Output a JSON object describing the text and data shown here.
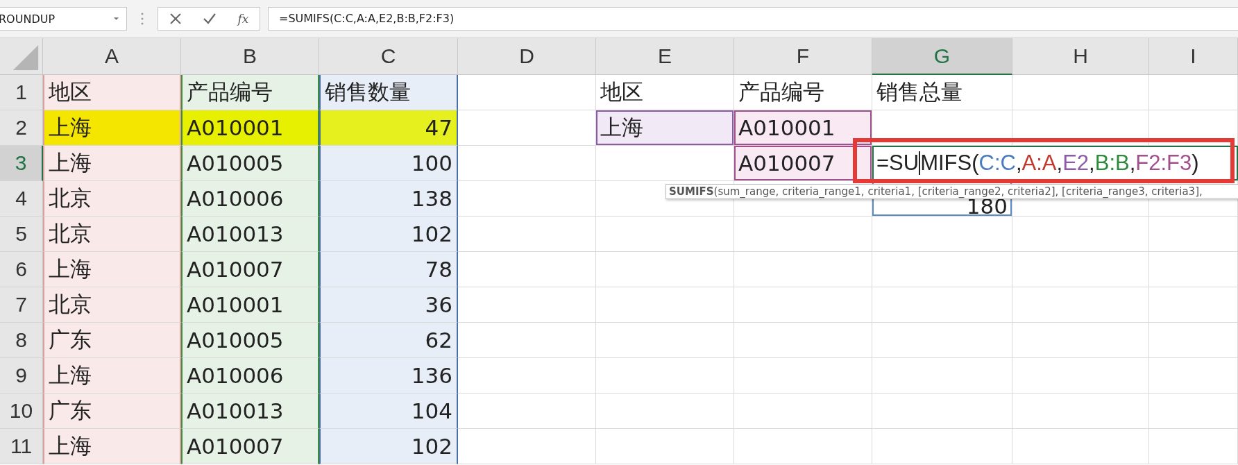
{
  "formula_bar": {
    "name_box": "ROUNDUP",
    "function_label": "fx",
    "formula": "=SUMIFS(C:C,A:A,E2,B:B,F2:F3)"
  },
  "columns": [
    {
      "label": "A",
      "selected": false,
      "border": {
        "color": "#d9a0a0"
      }
    },
    {
      "label": "B",
      "selected": false,
      "border": {
        "color": "#3c8c3c"
      }
    },
    {
      "label": "C",
      "selected": false,
      "border": {
        "color": "#4a6fa5"
      }
    },
    {
      "label": "D",
      "selected": false
    },
    {
      "label": "E",
      "selected": false
    },
    {
      "label": "F",
      "selected": false
    },
    {
      "label": "G",
      "selected": true
    },
    {
      "label": "H",
      "selected": false
    },
    {
      "label": "I",
      "selected": false
    }
  ],
  "rows": [
    {
      "label": "1",
      "selected": false,
      "cells": [
        {
          "text": "地区",
          "kind": "text",
          "color": "#f9e9e9"
        },
        {
          "text": "产品编号",
          "kind": "text",
          "color": "#e6f2e6"
        },
        {
          "text": "销售数量",
          "kind": "text",
          "color": "#e8eef8"
        },
        {},
        {
          "text": "地区",
          "kind": "text"
        },
        {
          "text": "产品编号",
          "kind": "text"
        },
        {
          "text": "销售总量",
          "kind": "text"
        },
        {},
        {}
      ]
    },
    {
      "label": "2",
      "selected": false,
      "cells": [
        {
          "text": "上海",
          "kind": "text",
          "color": "#f5e600"
        },
        {
          "text": "A010001",
          "kind": "text",
          "color": "#e6f000"
        },
        {
          "text": "47",
          "kind": "number",
          "color": "#e6f01e"
        },
        {},
        {
          "text": "上海",
          "kind": "text",
          "color": "#f1e9f5",
          "border": {
            "color": "#8e5aa8"
          }
        },
        {
          "text": "A010001",
          "kind": "text",
          "color": "#f9e9f3",
          "border": {
            "color": "#a0508c"
          }
        },
        {},
        {},
        {}
      ]
    },
    {
      "label": "3",
      "selected": true,
      "cells": [
        {
          "text": "上海",
          "kind": "text",
          "color": "#f9e9e9"
        },
        {
          "text": "A010005",
          "kind": "text",
          "color": "#e6f2e6"
        },
        {
          "text": "100",
          "kind": "number",
          "color": "#e8eef8"
        },
        {},
        {},
        {
          "text": "A010007",
          "kind": "text",
          "color": "#f9e9f3",
          "border": {
            "color": "#a0508c"
          }
        },
        {
          "editing": true,
          "segments": [
            {
              "text": "=SU",
              "color": "#222222",
              "cursor": true
            },
            {
              "text": "MIFS(",
              "color": "#222222"
            },
            {
              "text": "C:C",
              "color": "#4a7cc0"
            },
            {
              "text": ",",
              "color": "#222222"
            },
            {
              "text": "A:A",
              "color": "#c0392b"
            },
            {
              "text": ",",
              "color": "#222222"
            },
            {
              "text": "E2",
              "color": "#8e5aa8"
            },
            {
              "text": ",",
              "color": "#222222"
            },
            {
              "text": "B:B",
              "color": "#2e8b3a"
            },
            {
              "text": ",",
              "color": "#222222"
            },
            {
              "text": "F2:F3",
              "color": "#a0508c"
            },
            {
              "text": ")",
              "color": "#222222"
            }
          ]
        },
        {},
        {}
      ]
    },
    {
      "label": "4",
      "selected": false,
      "cells": [
        {
          "text": "北京",
          "kind": "text",
          "color": "#f9e9e9"
        },
        {
          "text": "A010006",
          "kind": "text",
          "color": "#e6f2e6"
        },
        {
          "text": "138",
          "kind": "number",
          "color": "#e8eef8"
        },
        {},
        {},
        {},
        {
          "text": "180",
          "kind": "number",
          "border": {
            "color": "#5b8bc9"
          }
        },
        {},
        {}
      ]
    },
    {
      "label": "5",
      "selected": false,
      "cells": [
        {
          "text": "北京",
          "kind": "text",
          "color": "#f9e9e9"
        },
        {
          "text": "A010013",
          "kind": "text",
          "color": "#e6f2e6"
        },
        {
          "text": "102",
          "kind": "number",
          "color": "#e8eef8"
        },
        {},
        {},
        {},
        {},
        {},
        {}
      ]
    },
    {
      "label": "6",
      "selected": false,
      "cells": [
        {
          "text": "上海",
          "kind": "text",
          "color": "#f9e9e9"
        },
        {
          "text": "A010007",
          "kind": "text",
          "color": "#e6f2e6"
        },
        {
          "text": "78",
          "kind": "number",
          "color": "#e8eef8"
        },
        {},
        {},
        {},
        {},
        {},
        {}
      ]
    },
    {
      "label": "7",
      "selected": false,
      "cells": [
        {
          "text": "北京",
          "kind": "text",
          "color": "#f9e9e9"
        },
        {
          "text": "A010001",
          "kind": "text",
          "color": "#e6f2e6"
        },
        {
          "text": "36",
          "kind": "number",
          "color": "#e8eef8"
        },
        {},
        {},
        {},
        {},
        {},
        {}
      ]
    },
    {
      "label": "8",
      "selected": false,
      "cells": [
        {
          "text": "广东",
          "kind": "text",
          "color": "#f9e9e9"
        },
        {
          "text": "A010005",
          "kind": "text",
          "color": "#e6f2e6"
        },
        {
          "text": "62",
          "kind": "number",
          "color": "#e8eef8"
        },
        {},
        {},
        {},
        {},
        {},
        {}
      ]
    },
    {
      "label": "9",
      "selected": false,
      "cells": [
        {
          "text": "上海",
          "kind": "text",
          "color": "#f9e9e9"
        },
        {
          "text": "A010006",
          "kind": "text",
          "color": "#e6f2e6"
        },
        {
          "text": "136",
          "kind": "number",
          "color": "#e8eef8"
        },
        {},
        {},
        {},
        {},
        {},
        {}
      ]
    },
    {
      "label": "10",
      "selected": false,
      "cells": [
        {
          "text": "广东",
          "kind": "text",
          "color": "#f9e9e9"
        },
        {
          "text": "A010013",
          "kind": "text",
          "color": "#e6f2e6"
        },
        {
          "text": "104",
          "kind": "number",
          "color": "#e8eef8"
        },
        {},
        {},
        {},
        {},
        {},
        {}
      ]
    },
    {
      "label": "11",
      "selected": false,
      "cells": [
        {
          "text": "上海",
          "kind": "text",
          "color": "#f9e9e9"
        },
        {
          "text": "A010007",
          "kind": "text",
          "color": "#e6f2e6"
        },
        {
          "text": "102",
          "kind": "number",
          "color": "#e8eef8"
        },
        {},
        {},
        {},
        {},
        {},
        {}
      ]
    }
  ],
  "tooltip": {
    "text": "**SUMIFS**(sum_range, criteria_range1, criteria1, [criteria_range2, criteria2], [criteria_range3, criteria3],"
  },
  "annotation": {
    "kind": "frame",
    "color": "#e53935"
  }
}
